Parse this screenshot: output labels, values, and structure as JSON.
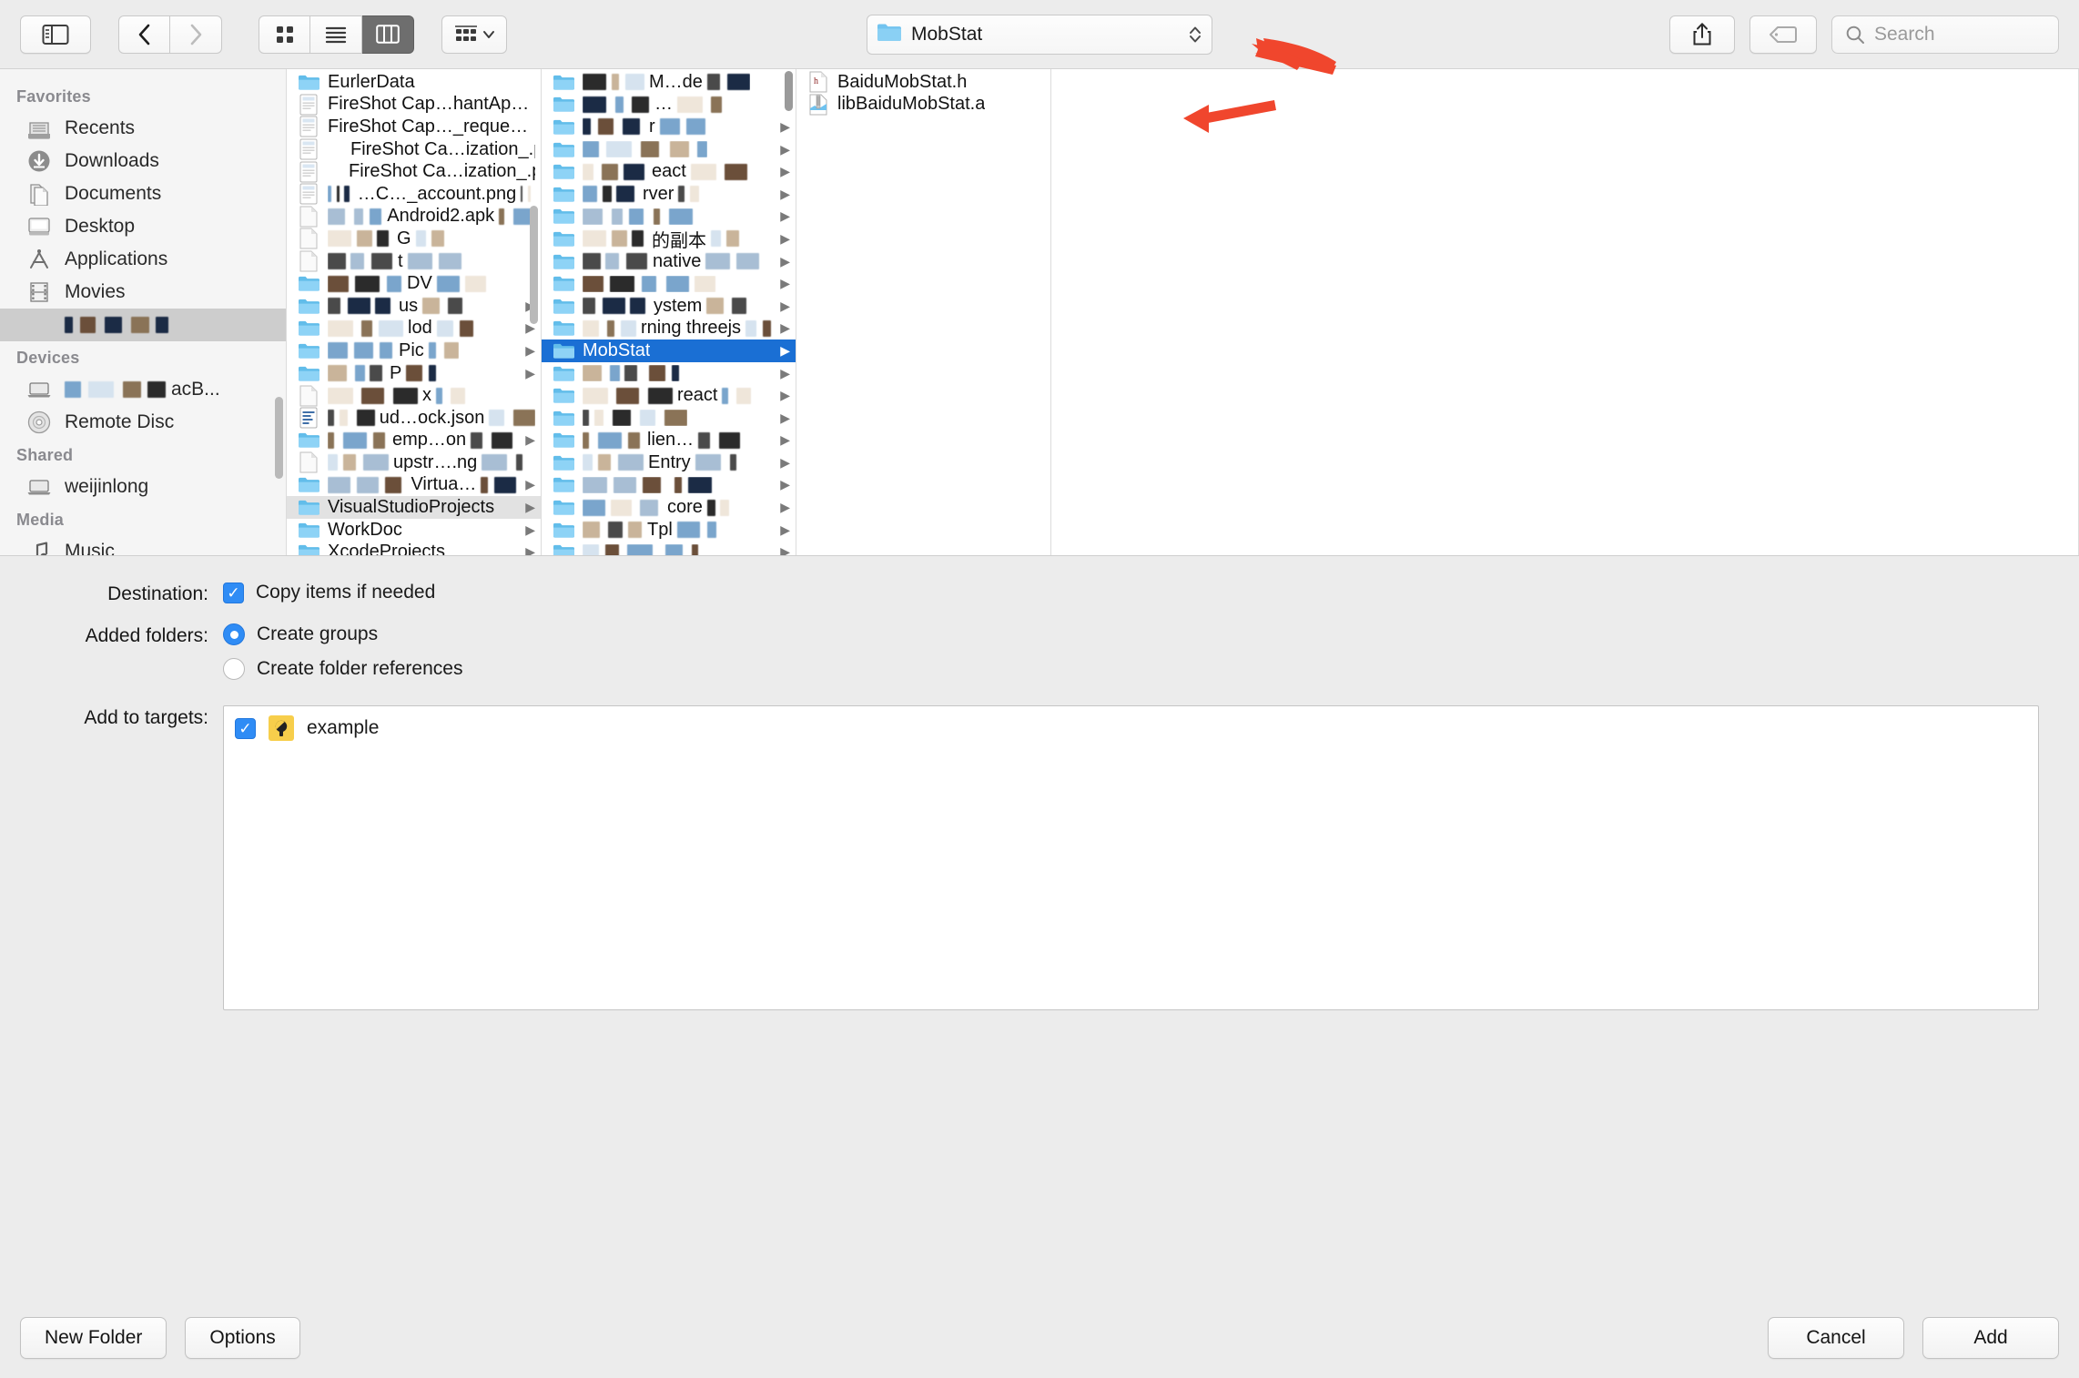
{
  "toolbar": {
    "sidebar_toggle": "sidebar-toggle",
    "back": "‹",
    "forward": "›",
    "view_icon": "icon-view",
    "view_list": "list-view",
    "view_column": "column-view",
    "arrange": "arrange",
    "path_label": "MobStat",
    "share": "share",
    "tag": "tag",
    "search_placeholder": "Search"
  },
  "sidebar": {
    "sections": [
      {
        "heading": "Favorites",
        "items": [
          {
            "label": "Recents",
            "icon": "recents-icon",
            "redacted": false,
            "selected": false
          },
          {
            "label": "Downloads",
            "icon": "downloads-icon",
            "redacted": false,
            "selected": false
          },
          {
            "label": "Documents",
            "icon": "documents-icon",
            "redacted": false,
            "selected": false
          },
          {
            "label": "Desktop",
            "icon": "desktop-icon",
            "redacted": false,
            "selected": false
          },
          {
            "label": "Applications",
            "icon": "applications-icon",
            "redacted": false,
            "selected": false
          },
          {
            "label": "Movies",
            "icon": "movies-icon",
            "redacted": false,
            "selected": false
          },
          {
            "label": "",
            "icon": "folder-icon",
            "redacted": true,
            "selected": true
          }
        ]
      },
      {
        "heading": "Devices",
        "items": [
          {
            "label": "acB...",
            "icon": "laptop-icon",
            "redacted": true,
            "selected": false
          },
          {
            "label": "Remote Disc",
            "icon": "disc-icon",
            "redacted": false,
            "selected": false
          }
        ]
      },
      {
        "heading": "Shared",
        "items": [
          {
            "label": "weijinlong",
            "icon": "laptop-icon",
            "redacted": false,
            "selected": false
          }
        ]
      },
      {
        "heading": "Media",
        "items": [
          {
            "label": "Music",
            "icon": "music-icon",
            "redacted": false,
            "selected": false
          }
        ]
      }
    ]
  },
  "columns": {
    "col1": [
      {
        "label": "EurlerData",
        "icon": "folder-icon",
        "redacted": false,
        "chevron": false
      },
      {
        "label": "FireShot Cap…hantApp.png",
        "icon": "image-file-icon",
        "redacted": false,
        "chevron": false
      },
      {
        "label": "FireShot Cap…_request.png",
        "icon": "image-file-icon",
        "redacted": false,
        "chevron": false
      },
      {
        "label": "FireShot Ca…ization_.png",
        "icon": "image-file-icon",
        "redacted": true,
        "chevron": false
      },
      {
        "label": "FireShot Ca…ization_.png",
        "icon": "image-file-icon",
        "redacted": true,
        "chevron": false
      },
      {
        "label": "…C…_account.png",
        "icon": "image-file-icon",
        "redacted": true,
        "chevron": false
      },
      {
        "label": "Android2.apk",
        "icon": "generic-file-icon",
        "redacted": true,
        "chevron": false
      },
      {
        "label": "G",
        "icon": "generic-file-icon",
        "redacted": true,
        "chevron": false
      },
      {
        "label": "t",
        "icon": "generic-file-icon",
        "redacted": true,
        "chevron": false
      },
      {
        "label": "DV",
        "icon": "folder-icon",
        "redacted": true,
        "chevron": false
      },
      {
        "label": "us",
        "icon": "folder-icon",
        "redacted": true,
        "chevron": true
      },
      {
        "label": "lod",
        "icon": "folder-icon",
        "redacted": true,
        "chevron": true
      },
      {
        "label": "Pic",
        "icon": "folder-icon",
        "redacted": true,
        "chevron": true
      },
      {
        "label": "P",
        "icon": "folder-icon",
        "redacted": true,
        "chevron": true
      },
      {
        "label": "x",
        "icon": "generic-file-icon",
        "redacted": true,
        "chevron": false
      },
      {
        "label": "ud…ock.json",
        "icon": "json-file-icon",
        "redacted": true,
        "chevron": false
      },
      {
        "label": "emp…on",
        "icon": "folder-icon",
        "redacted": true,
        "chevron": true
      },
      {
        "label": "upstr….ng",
        "icon": "generic-file-icon",
        "redacted": true,
        "chevron": false
      },
      {
        "label": "Virtua…",
        "icon": "folder-icon",
        "redacted": true,
        "chevron": true
      },
      {
        "label": "VisualStudioProjects",
        "icon": "folder-icon",
        "redacted": false,
        "chevron": true,
        "highlight": true
      },
      {
        "label": "WorkDoc",
        "icon": "folder-icon",
        "redacted": false,
        "chevron": true
      },
      {
        "label": "XcodeProjects",
        "icon": "folder-icon",
        "redacted": false,
        "chevron": true
      }
    ],
    "col2": [
      {
        "label": "M…de",
        "icon": "folder-icon",
        "redacted": true,
        "chevron": false
      },
      {
        "label": "…",
        "icon": "folder-icon",
        "redacted": true,
        "chevron": false
      },
      {
        "label": "r",
        "icon": "folder-icon",
        "redacted": true,
        "chevron": true
      },
      {
        "label": "",
        "icon": "folder-icon",
        "redacted": true,
        "chevron": true
      },
      {
        "label": "eact",
        "icon": "folder-icon",
        "redacted": true,
        "chevron": true
      },
      {
        "label": "rver",
        "icon": "folder-icon",
        "redacted": true,
        "chevron": true
      },
      {
        "label": "",
        "icon": "folder-icon",
        "redacted": true,
        "chevron": true
      },
      {
        "label": "的副本",
        "icon": "folder-icon",
        "redacted": true,
        "chevron": true
      },
      {
        "label": "native",
        "icon": "folder-icon",
        "redacted": true,
        "chevron": true
      },
      {
        "label": "",
        "icon": "folder-icon",
        "redacted": true,
        "chevron": true
      },
      {
        "label": "ystem",
        "icon": "folder-icon",
        "redacted": true,
        "chevron": true
      },
      {
        "label": "rning threejs",
        "icon": "folder-icon",
        "redacted": true,
        "chevron": true
      },
      {
        "label": "MobStat",
        "icon": "folder-icon",
        "redacted": false,
        "chevron": true,
        "selected": true
      },
      {
        "label": "",
        "icon": "folder-icon",
        "redacted": true,
        "chevron": true
      },
      {
        "label": "react",
        "icon": "folder-icon",
        "redacted": true,
        "chevron": true
      },
      {
        "label": "",
        "icon": "folder-icon",
        "redacted": true,
        "chevron": true
      },
      {
        "label": "lien…",
        "icon": "folder-icon",
        "redacted": true,
        "chevron": true
      },
      {
        "label": "Entry",
        "icon": "folder-icon",
        "redacted": true,
        "chevron": true
      },
      {
        "label": "",
        "icon": "folder-icon",
        "redacted": true,
        "chevron": true
      },
      {
        "label": "core",
        "icon": "folder-icon",
        "redacted": true,
        "chevron": true
      },
      {
        "label": "Tpl",
        "icon": "folder-icon",
        "redacted": true,
        "chevron": true
      },
      {
        "label": "",
        "icon": "folder-icon",
        "redacted": true,
        "chevron": true
      }
    ],
    "col3": [
      {
        "label": "BaiduMobStat.h",
        "icon": "h-file-icon",
        "redacted": false,
        "chevron": false
      },
      {
        "label": "libBaiduMobStat.a",
        "icon": "archive-file-icon",
        "redacted": false,
        "chevron": false
      }
    ]
  },
  "options": {
    "destination_label": "Destination:",
    "copy_items_label": "Copy items if needed",
    "added_folders_label": "Added folders:",
    "create_groups_label": "Create groups",
    "create_folder_refs_label": "Create folder references",
    "add_to_targets_label": "Add to targets:",
    "target_name": "example"
  },
  "footer": {
    "new_folder": "New Folder",
    "options": "Options",
    "cancel": "Cancel",
    "add": "Add"
  },
  "colors": {
    "selection_blue": "#1a6fd4",
    "accent_blue": "#2f8cf5",
    "annotation_red": "#f0462d",
    "folder_blue": "#6ec4f0"
  }
}
